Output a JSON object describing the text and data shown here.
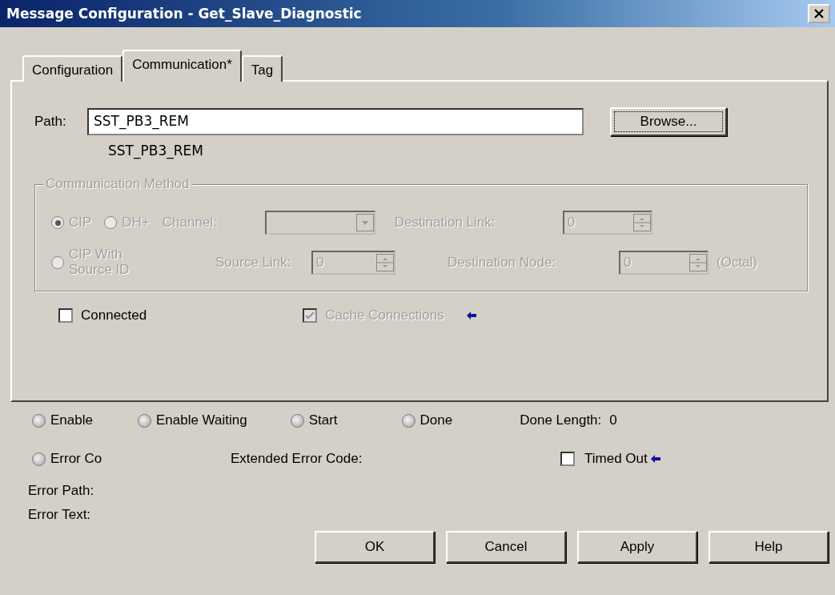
{
  "window": {
    "title": "Message Configuration - Get_Slave_Diagnostic"
  },
  "tabs": [
    {
      "label": "Configuration",
      "selected": false
    },
    {
      "label": "Communication*",
      "selected": true
    },
    {
      "label": "Tag",
      "selected": false
    }
  ],
  "path": {
    "label": "Path:",
    "value": "SST_PB3_REM",
    "resolved": "SST_PB3_REM",
    "browse": "Browse..."
  },
  "communication_method": {
    "title": "Communication Method",
    "disabled": true,
    "options": [
      {
        "label": "CIP",
        "selected": true
      },
      {
        "label": "DH+",
        "selected": false
      },
      {
        "label": "CIP With Source ID",
        "selected": false
      }
    ],
    "channel": {
      "label": "Channel:"
    },
    "source_link": {
      "label": "Source Link:",
      "value": "0"
    },
    "destination_link": {
      "label": "Destination Link:",
      "value": "0"
    },
    "destination_node": {
      "label": "Destination Node:",
      "value": "0",
      "unit": "(Octal)"
    }
  },
  "connected": {
    "label": "Connected",
    "checked": false
  },
  "cache_connections": {
    "label": "Cache Connections",
    "checked": true,
    "disabled": true
  },
  "status": [
    {
      "label": "Enable",
      "lit": false
    },
    {
      "label": "Enable Waiting",
      "lit": false
    },
    {
      "label": "Start",
      "lit": false
    },
    {
      "label": "Done",
      "lit": false
    }
  ],
  "done_length": {
    "label": "Done Length:",
    "value": "0"
  },
  "error_code": {
    "label": "Error Co",
    "lit": false
  },
  "extended_error_code": {
    "label": "Extended Error Code:"
  },
  "timed_out": {
    "label": "Timed Out",
    "checked": false
  },
  "error_path": {
    "label": "Error Path:"
  },
  "error_text": {
    "label": "Error Text:"
  },
  "buttons": [
    "OK",
    "Cancel",
    "Apply",
    "Help"
  ]
}
